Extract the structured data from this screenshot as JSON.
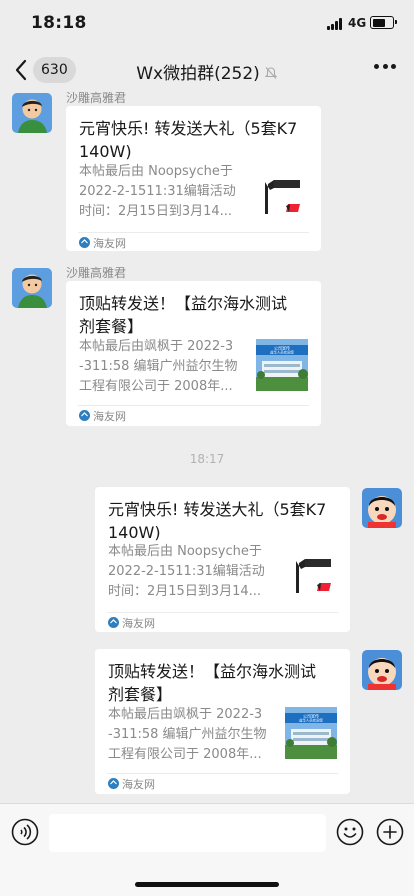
{
  "status_bar": {
    "time": "18:18",
    "network": "4G",
    "battery_level": 0.72
  },
  "nav": {
    "back_icon": "chevron-left-icon",
    "unread_count": "630",
    "title": "Wx微拍群(252)",
    "mute_icon": "bell-muted-icon",
    "more_icon": "ellipsis-icon"
  },
  "messages": [
    {
      "sender": "沙雕高雅君",
      "title": "元宵快乐! 转发送大礼（5套K7  140W)",
      "desc": [
        "本帖最后由 Noopsyche于",
        "2022-2-1511:31编辑活动",
        "时间：2月15日到3月14..."
      ],
      "source": "海友网"
    },
    {
      "sender": "沙雕高雅君",
      "title": "顶贴转发送！【益尔海水测试剂套餐】",
      "desc": [
        "本帖最后由飒枫于 2022-3",
        "-311:58 编辑广州益尔生物",
        "工程有限公司于 2008年..."
      ],
      "source": "海友网"
    },
    {
      "title": "元宵快乐! 转发送大礼（5套K7  140W)",
      "desc": [
        "本帖最后由 Noopsyche于",
        "2022-2-1511:31编辑活动",
        "时间：2月15日到3月14..."
      ],
      "source": "海友网"
    },
    {
      "title": "顶贴转发送！【益尔海水测试剂套餐】",
      "desc": [
        "本帖最后由飒枫于 2022-3",
        "-311:58 编辑广州益尔生物",
        "工程有限公司于 2008年..."
      ],
      "source": "海友网"
    }
  ],
  "timestamp": "18:17",
  "thumb_caption": [
    "公司宣传",
    "益华人员欢迎您"
  ],
  "input_bar": {
    "voice_icon": "voice-icon",
    "emoji_icon": "emoji-icon",
    "plus_icon": "plus-icon",
    "placeholder": ""
  },
  "colors": {
    "background": "#ededed",
    "card": "#ffffff",
    "badge": "#d9d9d9",
    "meta_text": "#888888"
  }
}
